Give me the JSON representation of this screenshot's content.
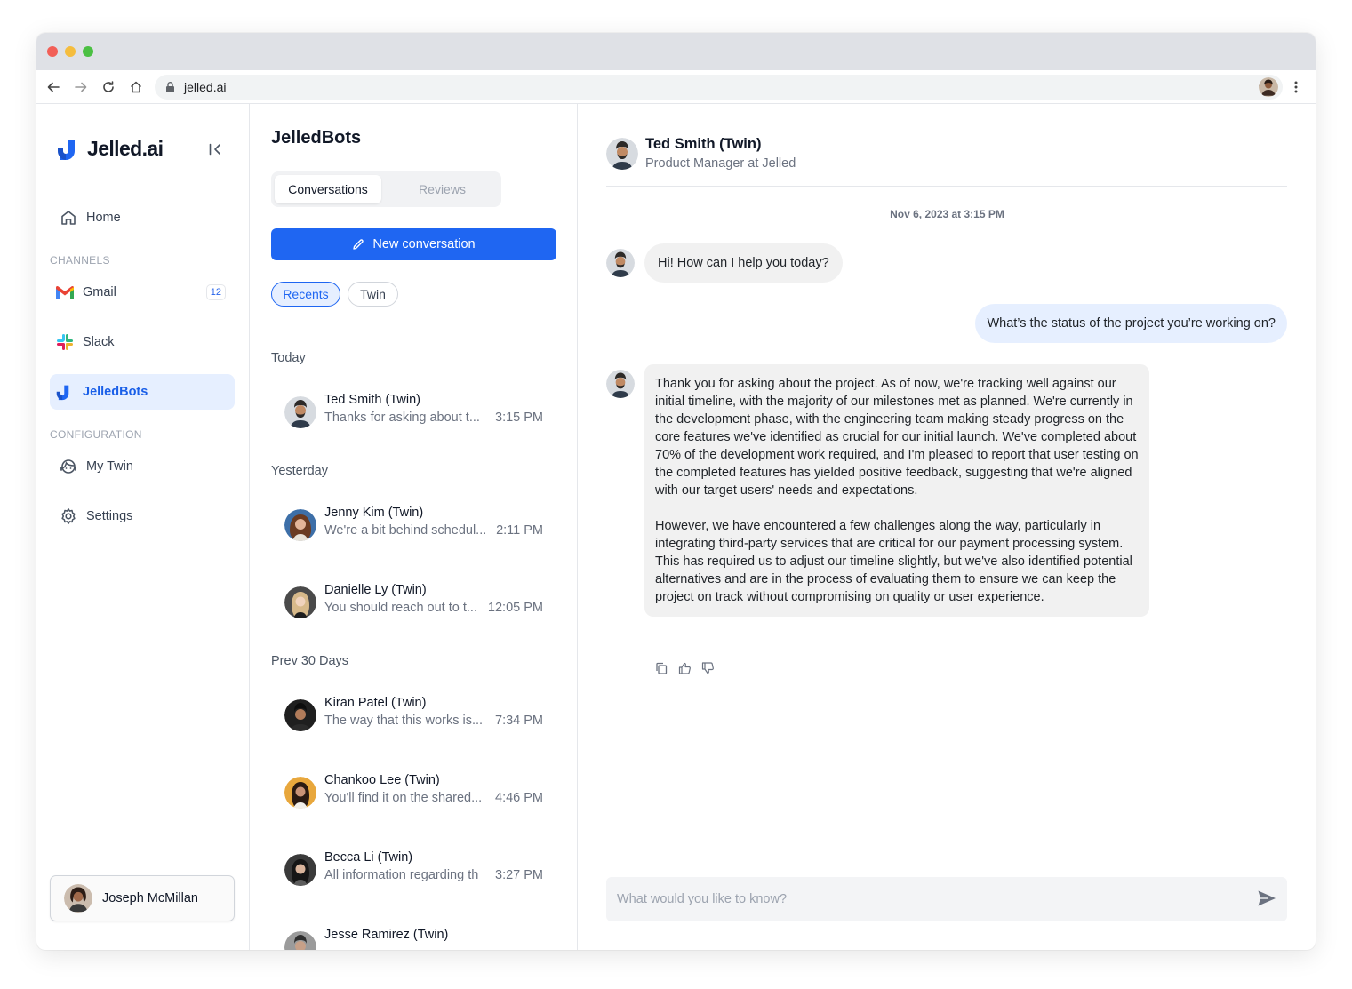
{
  "browser": {
    "url": "jelled.ai",
    "icons": [
      "back-icon",
      "forward-icon",
      "reload-icon",
      "home-icon",
      "lock-icon",
      "star-icon",
      "kebab-menu-icon"
    ]
  },
  "brand": {
    "name": "Jelled.ai",
    "accent": "#1f66f2"
  },
  "sidebar": {
    "home_label": "Home",
    "channels_label": "CHANNELS",
    "gmail_label": "Gmail",
    "gmail_badge": "12",
    "slack_label": "Slack",
    "jelledbots_label": "JelledBots",
    "configuration_label": "CONFIGURATION",
    "mytwin_label": "My Twin",
    "settings_label": "Settings",
    "user_name": "Joseph McMillan"
  },
  "conversations": {
    "title": "JelledBots",
    "tab_conversations": "Conversations",
    "tab_reviews": "Reviews",
    "new_button": "New conversation",
    "filter_recents": "Recents",
    "filter_twin": "Twin",
    "groups": [
      {
        "label": "Today",
        "items": [
          {
            "name": "Ted Smith (Twin)",
            "preview": "Thanks for asking about t...",
            "time": "3:15 PM"
          }
        ]
      },
      {
        "label": "Yesterday",
        "items": [
          {
            "name": "Jenny Kim (Twin)",
            "preview": "We're a bit behind schedul...",
            "time": "2:11 PM"
          },
          {
            "name": "Danielle Ly (Twin)",
            "preview": "You should reach out to t...",
            "time": "12:05 PM"
          }
        ]
      },
      {
        "label": "Prev 30 Days",
        "items": [
          {
            "name": "Kiran Patel (Twin)",
            "preview": "The way that this works is...",
            "time": "7:34 PM"
          },
          {
            "name": "Chankoo Lee (Twin)",
            "preview": "You'll find it on the shared...",
            "time": "4:46 PM"
          },
          {
            "name": "Becca Li (Twin)",
            "preview": "All information regarding th",
            "time": "3:27 PM"
          },
          {
            "name": "Jesse Ramirez (Twin)",
            "preview": "",
            "time": ""
          }
        ]
      }
    ]
  },
  "chat": {
    "contact_name": "Ted Smith (Twin)",
    "contact_role": "Product Manager at Jelled",
    "date": "Nov 6, 2023 at 3:15 PM",
    "bot_greeting": "Hi! How can I help you today?",
    "user_message": "What’s the status of the project you’re working on?",
    "bot_reply_p1": "Thank you for asking about the project. As of now, we're tracking well against our initial timeline, with the majority of our milestones met as planned. We're currently in the development phase, with the engineering team making steady progress on the core features we've identified as crucial for our initial launch. We've completed about 70% of the development work required, and I'm pleased to report that user testing on the completed features has yielded positive feedback, suggesting that we're aligned with our target users' needs and expectations.",
    "bot_reply_p2": "However, we have encountered a few challenges along the way, particularly in integrating third-party services that are critical for our payment processing system. This has required us to adjust our timeline slightly, but we've also identified potential alternatives and are in the process of evaluating them to ensure we can keep the project on track without compromising on quality or user experience.",
    "input_placeholder": "What would you like to know?"
  }
}
